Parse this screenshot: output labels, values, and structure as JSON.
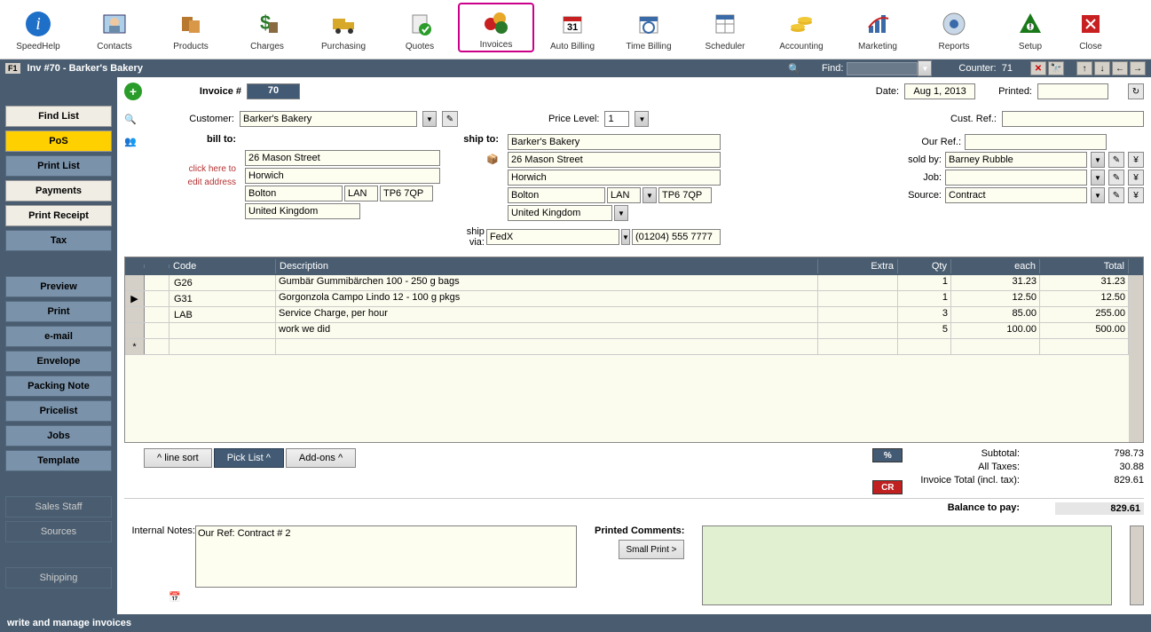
{
  "toolbar": {
    "items": [
      {
        "label": "SpeedHelp"
      },
      {
        "label": "Contacts"
      },
      {
        "label": "Products"
      },
      {
        "label": "Charges"
      },
      {
        "label": "Purchasing"
      },
      {
        "label": "Quotes"
      },
      {
        "label": "Invoices"
      },
      {
        "label": "Auto Billing"
      },
      {
        "label": "Time Billing"
      },
      {
        "label": "Scheduler"
      },
      {
        "label": "Accounting"
      },
      {
        "label": "Marketing"
      },
      {
        "label": "Reports"
      },
      {
        "label": "Setup"
      },
      {
        "label": "Close"
      }
    ]
  },
  "docbar": {
    "fn": "F1",
    "title": "Inv #70 - Barker's Bakery",
    "find_label": "Find:",
    "counter_label": "Counter:",
    "counter_value": "71"
  },
  "sidebar": {
    "find_list": "Find List",
    "pos": "PoS",
    "print_list": "Print List",
    "payments": "Payments",
    "print_receipt": "Print Receipt",
    "tax": "Tax",
    "preview": "Preview",
    "print": "Print",
    "email": "e-mail",
    "envelope": "Envelope",
    "packing_note": "Packing Note",
    "pricelist": "Pricelist",
    "jobs": "Jobs",
    "template": "Template",
    "sales_staff": "Sales Staff",
    "sources": "Sources",
    "shipping": "Shipping"
  },
  "header": {
    "invoice_num_label": "Invoice #",
    "invoice_num": "70",
    "date_label": "Date:",
    "date": "Aug 1, 2013",
    "printed_label": "Printed:",
    "printed": "",
    "customer_label": "Customer:",
    "customer": "Barker's Bakery",
    "price_level_label": "Price Level:",
    "price_level": "1",
    "cust_ref_label": "Cust. Ref.:",
    "cust_ref": "",
    "bill_to_label": "bill to:",
    "edit_hint_1": "click here to",
    "edit_hint_2": "edit address",
    "bill": {
      "l1": "26 Mason Street",
      "l2": "Horwich",
      "city": "Bolton",
      "state": "LAN",
      "zip": "TP6 7QP",
      "country": "United Kingdom"
    },
    "ship_to_label": "ship to:",
    "ship": {
      "name": "Barker's Bakery",
      "l1": "26 Mason Street",
      "l2": "Horwich",
      "city": "Bolton",
      "state": "LAN",
      "zip": "TP6 7QP",
      "country": "United Kingdom"
    },
    "ship_via_label": "ship via:",
    "ship_via": "FedX",
    "ship_phone": "(01204) 555 7777",
    "our_ref_label": "Our Ref.:",
    "our_ref": "",
    "sold_by_label": "sold by:",
    "sold_by": "Barney Rubble",
    "job_label": "Job:",
    "job": "",
    "source_label": "Source:",
    "source": "Contract"
  },
  "grid": {
    "headers": {
      "code": "Code",
      "desc": "Description",
      "extra": "Extra",
      "qty": "Qty",
      "each": "each",
      "total": "Total"
    },
    "rows": [
      {
        "code": "G26",
        "desc": "Gumbär Gummibärchen 100 - 250 g bags",
        "qty": "1",
        "each": "31.23",
        "total": "31.23"
      },
      {
        "code": "G31",
        "desc": "Gorgonzola Campo Lindo 12 - 100 g pkgs",
        "qty": "1",
        "each": "12.50",
        "total": "12.50"
      },
      {
        "code": "LAB",
        "desc": "Service Charge, per hour",
        "qty": "3",
        "each": "85.00",
        "total": "255.00"
      },
      {
        "code": "",
        "desc": "work we did",
        "qty": "5",
        "each": "100.00",
        "total": "500.00"
      }
    ]
  },
  "below": {
    "line_sort": "^ line sort",
    "pick_list": "Pick List ^",
    "addons": "Add-ons ^",
    "pct": "%",
    "cr": "CR",
    "subtotal_label": "Subtotal:",
    "subtotal": "798.73",
    "taxes_label": "All Taxes:",
    "taxes": "30.88",
    "total_label": "Invoice Total (incl. tax):",
    "total": "829.61",
    "balance_label": "Balance to pay:",
    "balance": "829.61"
  },
  "notes": {
    "internal_label": "Internal Notes:",
    "internal": "Our Ref: Contract # 2",
    "printed_comments_label": "Printed Comments:",
    "small_print": "Small Print >"
  },
  "status": "write and manage invoices"
}
